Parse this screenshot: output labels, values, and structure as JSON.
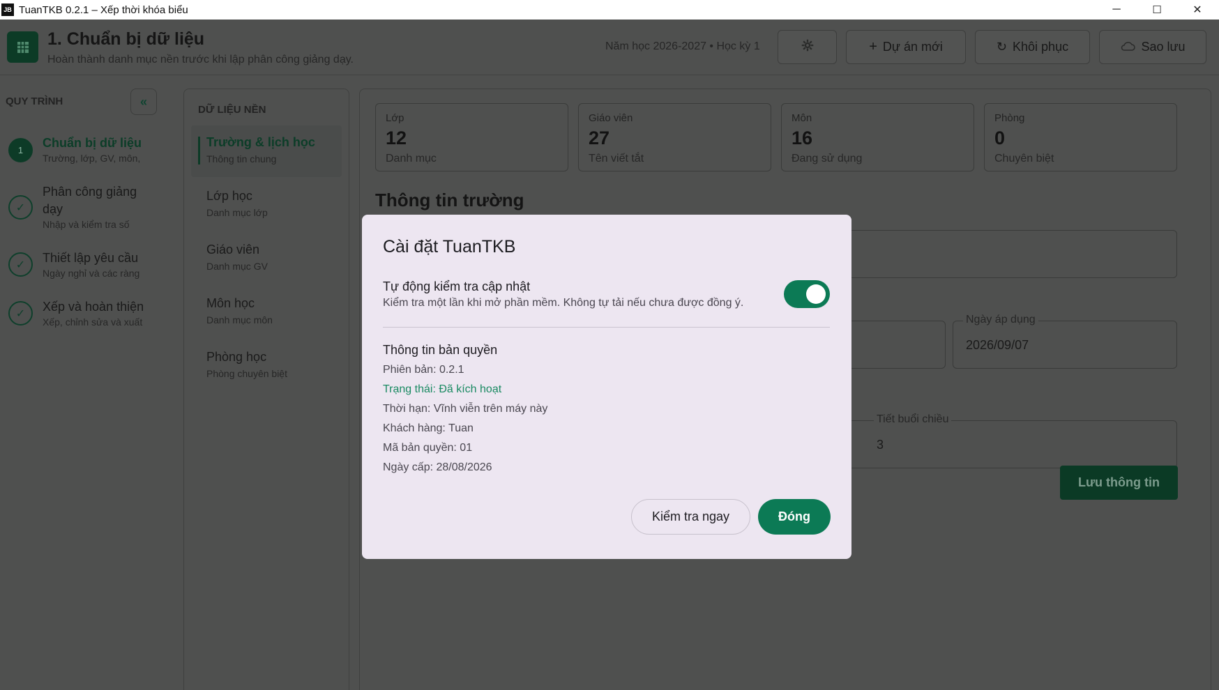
{
  "window": {
    "logo_text": "JB",
    "title": "TuanTKB 0.2.1 – Xếp thời khóa biểu",
    "minimize": "─",
    "maximize": "☐",
    "close": "✕"
  },
  "header": {
    "title": "1. Chuẩn bị dữ liệu",
    "subtitle": "Hoàn thành danh mục nền trước khi lập phân công giảng dạy.",
    "meta": "Năm học 2026-2027  •  Học kỳ 1",
    "settings_icon": "gear-icon",
    "new_project_label": "Dự án mới",
    "restore_label": "Khôi phục",
    "backup_label": "Sao lưu"
  },
  "workflow": {
    "title": "QUY TRÌNH",
    "collapse_glyph": "«",
    "items": [
      {
        "number": "1",
        "label": "Chuẩn bị dữ liệu",
        "desc": "Trường, lớp, GV, môn,",
        "state": "active"
      },
      {
        "label": "Phân công giảng dạy",
        "desc": "Nhập và kiểm tra số",
        "state": "done"
      },
      {
        "label": "Thiết lập yêu cầu",
        "desc": "Ngày nghỉ và các ràng",
        "state": "done"
      },
      {
        "label": "Xếp và hoàn thiện",
        "desc": "Xếp, chỉnh sửa và xuất",
        "state": "done"
      }
    ]
  },
  "data_nav": {
    "title": "DỮ LIỆU NỀN",
    "items": [
      {
        "label": "Trường & lịch học",
        "desc": "Thông tin chung"
      },
      {
        "label": "Lớp học",
        "desc": "Danh mục lớp"
      },
      {
        "label": "Giáo viên",
        "desc": "Danh mục GV"
      },
      {
        "label": "Môn học",
        "desc": "Danh mục môn"
      },
      {
        "label": "Phòng học",
        "desc": "Phòng chuyên biệt"
      }
    ]
  },
  "stats": [
    {
      "label": "Lớp",
      "value": "12",
      "desc": "Danh mục"
    },
    {
      "label": "Giáo viên",
      "value": "27",
      "desc": "Tên viết tắt"
    },
    {
      "label": "Môn",
      "value": "16",
      "desc": "Đang sử dụng"
    },
    {
      "label": "Phòng",
      "value": "0",
      "desc": "Chuyên biệt"
    }
  ],
  "school_info": {
    "title": "Thông tin trường",
    "apply_date_label": "Ngày áp dụng",
    "apply_date_value": "2026/09/07",
    "afternoon_periods_label": "Tiết buổi chiều",
    "afternoon_periods_value": "3",
    "save_label": "Lưu thông tin"
  },
  "modal": {
    "title": "Cài đặt TuanTKB",
    "auto_update_label": "Tự động kiểm tra cập nhật",
    "auto_update_desc": "Kiểm tra một lần khi mở phần mềm. Không tự tải nếu chưa được đồng ý.",
    "auto_update_on": true,
    "license_title": "Thông tin bản quyền",
    "version": "Phiên bản: 0.2.1",
    "status": "Trạng thái: Đã kích hoạt",
    "term": "Thời hạn: Vĩnh viễn trên máy này",
    "customer": "Khách hàng: Tuan",
    "license_code": "Mã bản quyền: 01",
    "issue_date": "Ngày cấp: 28/08/2026",
    "check_now_label": "Kiểm tra ngay",
    "close_label": "Đóng"
  },
  "colors": {
    "accent": "#0c7a55",
    "dim_background": "#4f504f",
    "modal_background": "#ede6f1"
  }
}
